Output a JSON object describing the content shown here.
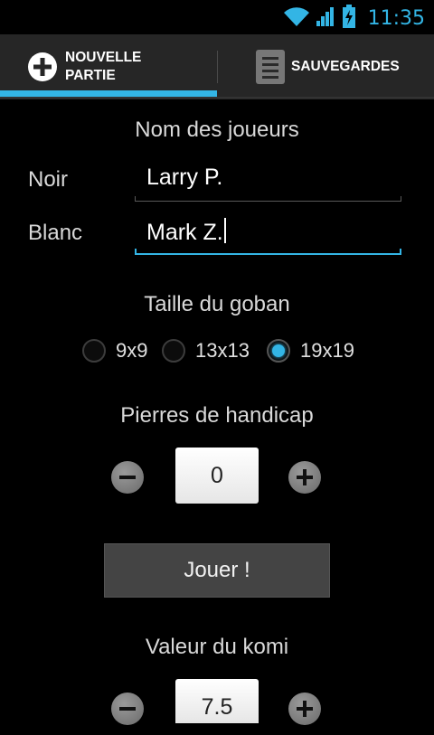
{
  "status_bar": {
    "time": "11:35",
    "icons": [
      "wifi-icon",
      "signal-icon",
      "battery-charging-icon"
    ]
  },
  "tabs": [
    {
      "label_line1": "NOUVELLE",
      "label_line2": "PARTIE",
      "icon": "plus-circle-icon",
      "selected": true
    },
    {
      "label": "SAUVEGARDES",
      "icon": "list-document-icon",
      "selected": false
    }
  ],
  "players": {
    "title": "Nom des joueurs",
    "black_label": "Noir",
    "black_value": "Larry P.",
    "white_label": "Blanc",
    "white_value": "Mark Z."
  },
  "board_size": {
    "title": "Taille du goban",
    "options": [
      "9x9",
      "13x13",
      "19x19"
    ],
    "selected": "19x19"
  },
  "handicap": {
    "title": "Pierres de handicap",
    "value": "0"
  },
  "play_button": "Jouer !",
  "komi": {
    "title": "Valeur du komi",
    "value": "7.5"
  },
  "colors": {
    "accent": "#33b5e5",
    "background": "#000000",
    "tabbar": "#262626"
  }
}
